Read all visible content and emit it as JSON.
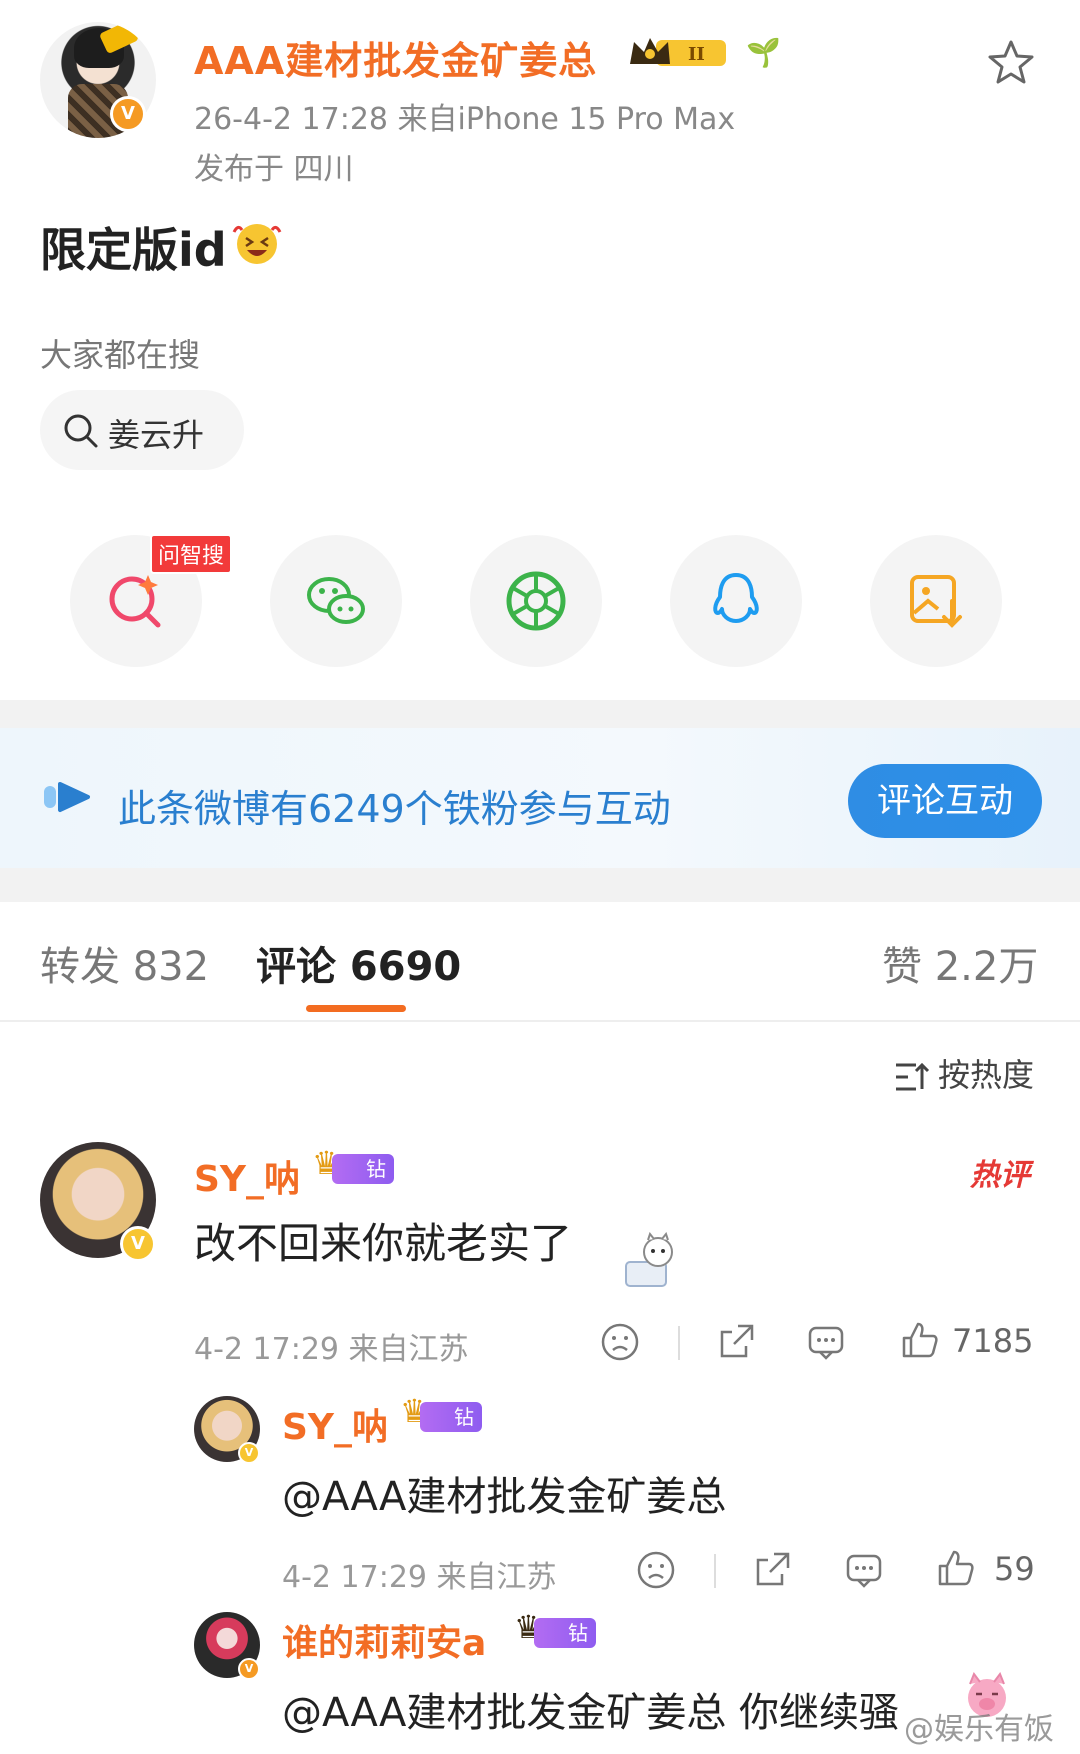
{
  "post": {
    "author": "AAA建材批发金矿姜总",
    "level_badge": "II",
    "time_source": "26-4-2 17:28  来自iPhone 15 Pro Max",
    "location": "发布于 四川",
    "text": "限定版id"
  },
  "search": {
    "label": "大家都在搜",
    "chip": "姜云升"
  },
  "share": {
    "ai_tag": "问智搜",
    "items": [
      "ai-search-icon",
      "wechat-icon",
      "moments-icon",
      "qq-icon",
      "save-image-icon"
    ]
  },
  "fan_banner": {
    "text": "此条微博有6249个铁粉参与互动",
    "button": "评论互动"
  },
  "tabs": {
    "repost": "转发 832",
    "comments": "评论 6690",
    "likes": "赞 2.2万"
  },
  "sort": "按热度",
  "comments": [
    {
      "user": "SY_呐",
      "badge": "钻粉4",
      "badge_level": "6",
      "text": "改不回来你就老实了",
      "hot": "热评",
      "meta": "4-2 17:29  来自江苏",
      "likes": "7185",
      "replies": [
        {
          "user": "SY_呐",
          "badge": "钻粉4",
          "badge_level": "6",
          "text": "@AAA建材批发金矿姜总",
          "meta": "4-2 17:29  来自江苏",
          "likes": "59"
        },
        {
          "user": "谁的莉莉安a",
          "badge": "钻粉4",
          "badge_level": "1",
          "text": "@AAA建材批发金矿姜总 你继续骚"
        }
      ]
    }
  ],
  "watermark": "@娱乐有饭",
  "colors": {
    "accent": "#f26d25",
    "link_blue": "#2a7fcf",
    "hot_red": "#e53935"
  }
}
